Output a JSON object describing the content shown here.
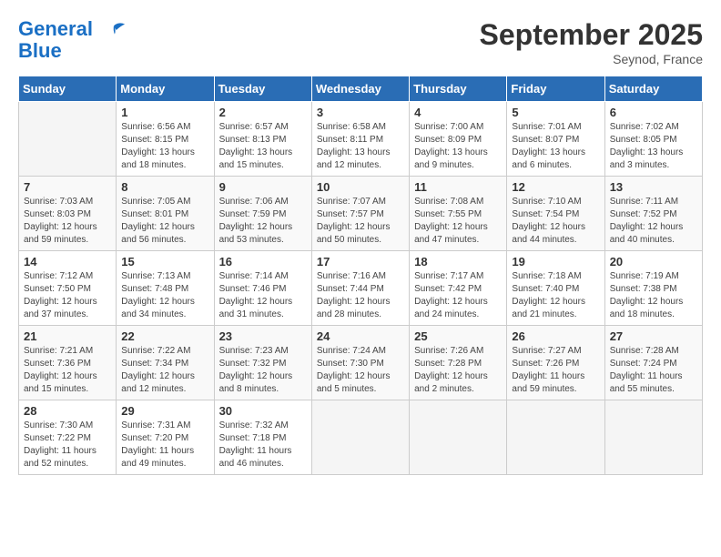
{
  "logo": {
    "line1": "General",
    "line2": "Blue"
  },
  "title": "September 2025",
  "subtitle": "Seynod, France",
  "weekdays": [
    "Sunday",
    "Monday",
    "Tuesday",
    "Wednesday",
    "Thursday",
    "Friday",
    "Saturday"
  ],
  "weeks": [
    [
      {
        "day": "",
        "info": ""
      },
      {
        "day": "1",
        "info": "Sunrise: 6:56 AM\nSunset: 8:15 PM\nDaylight: 13 hours\nand 18 minutes."
      },
      {
        "day": "2",
        "info": "Sunrise: 6:57 AM\nSunset: 8:13 PM\nDaylight: 13 hours\nand 15 minutes."
      },
      {
        "day": "3",
        "info": "Sunrise: 6:58 AM\nSunset: 8:11 PM\nDaylight: 13 hours\nand 12 minutes."
      },
      {
        "day": "4",
        "info": "Sunrise: 7:00 AM\nSunset: 8:09 PM\nDaylight: 13 hours\nand 9 minutes."
      },
      {
        "day": "5",
        "info": "Sunrise: 7:01 AM\nSunset: 8:07 PM\nDaylight: 13 hours\nand 6 minutes."
      },
      {
        "day": "6",
        "info": "Sunrise: 7:02 AM\nSunset: 8:05 PM\nDaylight: 13 hours\nand 3 minutes."
      }
    ],
    [
      {
        "day": "7",
        "info": "Sunrise: 7:03 AM\nSunset: 8:03 PM\nDaylight: 12 hours\nand 59 minutes."
      },
      {
        "day": "8",
        "info": "Sunrise: 7:05 AM\nSunset: 8:01 PM\nDaylight: 12 hours\nand 56 minutes."
      },
      {
        "day": "9",
        "info": "Sunrise: 7:06 AM\nSunset: 7:59 PM\nDaylight: 12 hours\nand 53 minutes."
      },
      {
        "day": "10",
        "info": "Sunrise: 7:07 AM\nSunset: 7:57 PM\nDaylight: 12 hours\nand 50 minutes."
      },
      {
        "day": "11",
        "info": "Sunrise: 7:08 AM\nSunset: 7:55 PM\nDaylight: 12 hours\nand 47 minutes."
      },
      {
        "day": "12",
        "info": "Sunrise: 7:10 AM\nSunset: 7:54 PM\nDaylight: 12 hours\nand 44 minutes."
      },
      {
        "day": "13",
        "info": "Sunrise: 7:11 AM\nSunset: 7:52 PM\nDaylight: 12 hours\nand 40 minutes."
      }
    ],
    [
      {
        "day": "14",
        "info": "Sunrise: 7:12 AM\nSunset: 7:50 PM\nDaylight: 12 hours\nand 37 minutes."
      },
      {
        "day": "15",
        "info": "Sunrise: 7:13 AM\nSunset: 7:48 PM\nDaylight: 12 hours\nand 34 minutes."
      },
      {
        "day": "16",
        "info": "Sunrise: 7:14 AM\nSunset: 7:46 PM\nDaylight: 12 hours\nand 31 minutes."
      },
      {
        "day": "17",
        "info": "Sunrise: 7:16 AM\nSunset: 7:44 PM\nDaylight: 12 hours\nand 28 minutes."
      },
      {
        "day": "18",
        "info": "Sunrise: 7:17 AM\nSunset: 7:42 PM\nDaylight: 12 hours\nand 24 minutes."
      },
      {
        "day": "19",
        "info": "Sunrise: 7:18 AM\nSunset: 7:40 PM\nDaylight: 12 hours\nand 21 minutes."
      },
      {
        "day": "20",
        "info": "Sunrise: 7:19 AM\nSunset: 7:38 PM\nDaylight: 12 hours\nand 18 minutes."
      }
    ],
    [
      {
        "day": "21",
        "info": "Sunrise: 7:21 AM\nSunset: 7:36 PM\nDaylight: 12 hours\nand 15 minutes."
      },
      {
        "day": "22",
        "info": "Sunrise: 7:22 AM\nSunset: 7:34 PM\nDaylight: 12 hours\nand 12 minutes."
      },
      {
        "day": "23",
        "info": "Sunrise: 7:23 AM\nSunset: 7:32 PM\nDaylight: 12 hours\nand 8 minutes."
      },
      {
        "day": "24",
        "info": "Sunrise: 7:24 AM\nSunset: 7:30 PM\nDaylight: 12 hours\nand 5 minutes."
      },
      {
        "day": "25",
        "info": "Sunrise: 7:26 AM\nSunset: 7:28 PM\nDaylight: 12 hours\nand 2 minutes."
      },
      {
        "day": "26",
        "info": "Sunrise: 7:27 AM\nSunset: 7:26 PM\nDaylight: 11 hours\nand 59 minutes."
      },
      {
        "day": "27",
        "info": "Sunrise: 7:28 AM\nSunset: 7:24 PM\nDaylight: 11 hours\nand 55 minutes."
      }
    ],
    [
      {
        "day": "28",
        "info": "Sunrise: 7:30 AM\nSunset: 7:22 PM\nDaylight: 11 hours\nand 52 minutes."
      },
      {
        "day": "29",
        "info": "Sunrise: 7:31 AM\nSunset: 7:20 PM\nDaylight: 11 hours\nand 49 minutes."
      },
      {
        "day": "30",
        "info": "Sunrise: 7:32 AM\nSunset: 7:18 PM\nDaylight: 11 hours\nand 46 minutes."
      },
      {
        "day": "",
        "info": ""
      },
      {
        "day": "",
        "info": ""
      },
      {
        "day": "",
        "info": ""
      },
      {
        "day": "",
        "info": ""
      }
    ]
  ]
}
